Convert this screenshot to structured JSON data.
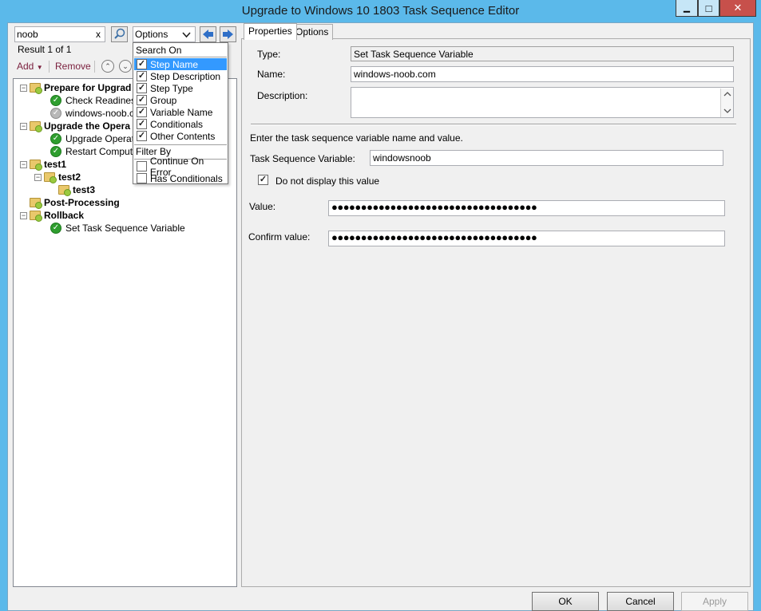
{
  "window": {
    "title": "Upgrade to Windows 10 1803 Task Sequence Editor",
    "controls": {
      "minimize": "▁",
      "maximize": "□",
      "close": "✕"
    }
  },
  "search": {
    "value": "noob",
    "clear_label": "x",
    "result_text": "Result 1 of 1",
    "options_label": "Options",
    "icons": {
      "search": "search-icon",
      "prev": "arrow-left-icon",
      "next": "arrow-right-icon"
    }
  },
  "toolbar": {
    "add_label": "Add",
    "remove_label": "Remove"
  },
  "options_menu": {
    "search_on_header": "Search On",
    "search_on": [
      {
        "label": "Step Name",
        "checked": true,
        "highlighted": true
      },
      {
        "label": "Step Description",
        "checked": true
      },
      {
        "label": "Step Type",
        "checked": true
      },
      {
        "label": "Group",
        "checked": true
      },
      {
        "label": "Variable Name",
        "checked": true
      },
      {
        "label": "Conditionals",
        "checked": true
      },
      {
        "label": "Other Contents",
        "checked": true
      }
    ],
    "filter_by_header": "Filter By",
    "filter_by": [
      {
        "label": "Continue On Error",
        "checked": false
      },
      {
        "label": "Has Conditionals",
        "checked": false
      }
    ]
  },
  "tree": [
    {
      "label": "Prepare for Upgrad",
      "type": "group",
      "level": 0
    },
    {
      "label": "Check Readiness",
      "type": "ok",
      "level": 1
    },
    {
      "label": "windows-noob.com",
      "type": "disabled",
      "level": 1
    },
    {
      "label": "Upgrade the Opera",
      "type": "group",
      "level": 0
    },
    {
      "label": "Upgrade Operating",
      "type": "ok",
      "level": 1
    },
    {
      "label": "Restart Computer",
      "type": "ok",
      "level": 1
    },
    {
      "label": "test1",
      "type": "group",
      "level": 0
    },
    {
      "label": "test2",
      "type": "group",
      "level": 1
    },
    {
      "label": "test3",
      "type": "group-leaf",
      "level": 2
    },
    {
      "label": "Post-Processing",
      "type": "group-leaf",
      "level": 0
    },
    {
      "label": "Rollback",
      "type": "group",
      "level": 0
    },
    {
      "label": "Set Task Sequence Variable",
      "type": "ok",
      "level": 1
    }
  ],
  "tabs": [
    {
      "label": "Properties",
      "active": true
    },
    {
      "label": "Options",
      "active": false
    }
  ],
  "properties": {
    "type_label": "Type:",
    "type_value": "Set Task Sequence Variable",
    "name_label": "Name:",
    "name_value": "windows-noob.com",
    "description_label": "Description:",
    "description_value": "",
    "instruction": "Enter the task sequence variable name and value.",
    "variable_label": "Task Sequence Variable:",
    "variable_value": "windowsnoob",
    "hide_value_label": "Do not display this value",
    "hide_value_checked": true,
    "value_label": "Value:",
    "value_masked": "●●●●●●●●●●●●●●●●●●●●●●●●●●●●●●●●●●●●",
    "confirm_label": "Confirm value:",
    "confirm_masked": "●●●●●●●●●●●●●●●●●●●●●●●●●●●●●●●●●●●●"
  },
  "footer": {
    "ok_label": "OK",
    "cancel_label": "Cancel",
    "apply_label": "Apply"
  },
  "colors": {
    "titlebar": "#5bb9ea",
    "highlight": "#3399ff",
    "close": "#c7504b"
  }
}
